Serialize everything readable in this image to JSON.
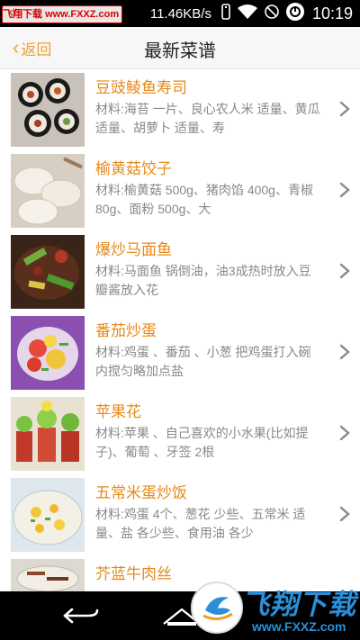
{
  "status_bar": {
    "badge_label": "飞翔下载",
    "badge_site": "www.FXXZ.com",
    "net_speed": "11.46KB/s",
    "time": "10:19",
    "icons": [
      "vibrate-icon",
      "wifi-icon",
      "no-sim-icon",
      "sync-icon"
    ]
  },
  "header": {
    "back_label": "返回",
    "title": "最新菜谱"
  },
  "recipes": [
    {
      "title": "豆豉鲮鱼寿司",
      "desc": "材料:海苔 一片、良心农人米 适量、黄瓜 适量、胡萝卜 适量、寿"
    },
    {
      "title": "榆黄菇饺子",
      "desc": "材料:榆黄菇 500g、猪肉馅 400g、青椒 80g、面粉 500g、大"
    },
    {
      "title": "爆炒马面鱼",
      "desc": "材料:马面鱼 锅倒油，油3成热时放入豆瓣酱放入花"
    },
    {
      "title": "番茄炒蛋",
      "desc": "材料:鸡蛋 、番茄 、小葱 把鸡蛋打入碗内搅匀略加点盐"
    },
    {
      "title": "苹果花",
      "desc": "材料:苹果 、自己喜欢的小水果(比如提子)、葡萄 、牙签 2根"
    },
    {
      "title": "五常米蛋炒饭",
      "desc": "材料:鸡蛋 4个、葱花 少些、五常米 适量、盐 各少些、食用油 各少"
    },
    {
      "title": "芥蓝牛肉丝",
      "desc": ""
    }
  ],
  "watermark": {
    "title": "飞翔下载",
    "url": "www.FXXZ.com"
  },
  "colors": {
    "accent": "#e68a1a",
    "back": "#e8a23a",
    "watermark": "#2a8fd8"
  }
}
